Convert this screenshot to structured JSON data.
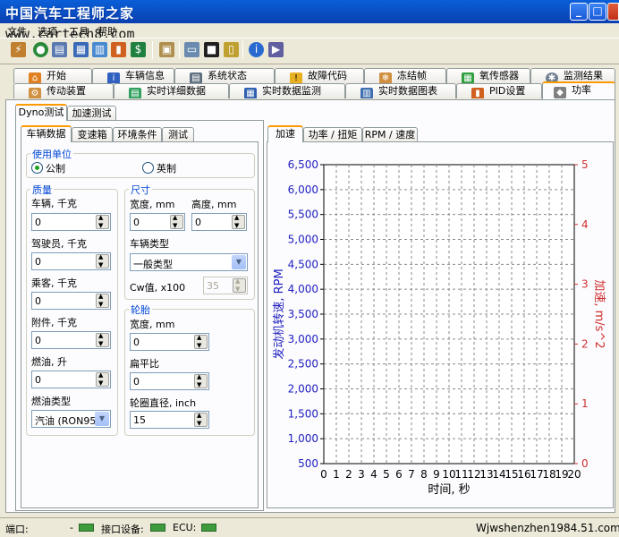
{
  "watermark_top": "中国汽车工程师之家",
  "watermark_url": "www.cartech8.com",
  "watermark_bottom": "Wjwshenzhen1984.51.com",
  "menu": [
    "文件",
    "选项",
    "工具",
    "帮助"
  ],
  "main_tabs_row1": [
    "开始",
    "车辆信息",
    "系统状态",
    "故障代码",
    "冻结帧",
    "氧传感器",
    "监测结果"
  ],
  "main_tabs_row2": [
    "传动装置",
    "实时详细数据",
    "实时数据监测",
    "实时数据图表",
    "PID设置",
    "功率"
  ],
  "sub_tabs": [
    "Dyno测试",
    "加速测试"
  ],
  "config_tabs": [
    "车辆数据",
    "变速箱",
    "环境条件",
    "测试"
  ],
  "units": {
    "title": "使用单位",
    "metric": "公制",
    "imperial": "英制"
  },
  "mass": {
    "title": "质量",
    "vehicle_label": "车辆, 千克",
    "vehicle": "0",
    "driver_label": "驾驶员, 千克",
    "driver": "0",
    "passenger_label": "乘客, 千克",
    "passenger": "0",
    "accessory_label": "附件, 千克",
    "accessory": "0",
    "fuel_label": "燃油, 升",
    "fuel": "0",
    "fuel_type_label": "燃油类型",
    "fuel_type": "汽油 (RON95)"
  },
  "dimensions": {
    "title": "尺寸",
    "width_label": "宽度, mm",
    "width": "0",
    "height_label": "高度, mm",
    "height": "0",
    "vehicle_type_label": "车辆类型",
    "vehicle_type": "一般类型",
    "cw_label": "Cw值, x100",
    "cw": "35"
  },
  "tire": {
    "title": "轮胎",
    "width_label": "宽度, mm",
    "width": "0",
    "aspect_label": "扁平比",
    "aspect": "0",
    "rim_label": "轮圈直径, inch",
    "rim": "15"
  },
  "chart_tabs": [
    "加速",
    "功率 / 扭矩",
    "RPM / 速度"
  ],
  "status": {
    "port_label": "端口:",
    "port_value": "-",
    "device_label": "接口设备:",
    "ecu_label": "ECU:"
  },
  "colors": {
    "left_axis": "#2020c0",
    "right_axis": "#d03030",
    "title_bar": "#0a4fc8"
  },
  "chart_data": {
    "type": "line",
    "xlabel": "时间, 秒",
    "ylabel": "发动机转速, RPM",
    "y2label": "加速, m/s^2",
    "xlim": [
      0,
      20
    ],
    "x_ticks": [
      0,
      1,
      2,
      3,
      4,
      5,
      6,
      7,
      8,
      9,
      10,
      11,
      12,
      13,
      14,
      15,
      16,
      17,
      18,
      19,
      20
    ],
    "ylim": [
      500,
      6500
    ],
    "y_ticks": [
      500,
      1000,
      1500,
      2000,
      2500,
      3000,
      3500,
      4000,
      4500,
      5000,
      5500,
      6000,
      6500
    ],
    "y_tick_labels": [
      "500",
      "1,000",
      "1,500",
      "2,000",
      "2,500",
      "3,000",
      "3,500",
      "4,000",
      "4,500",
      "5,000",
      "5,500",
      "6,000",
      "6,500"
    ],
    "y2lim": [
      0,
      5
    ],
    "y2_ticks": [
      0,
      1,
      2,
      3,
      4,
      5
    ],
    "grid": true,
    "series": []
  }
}
